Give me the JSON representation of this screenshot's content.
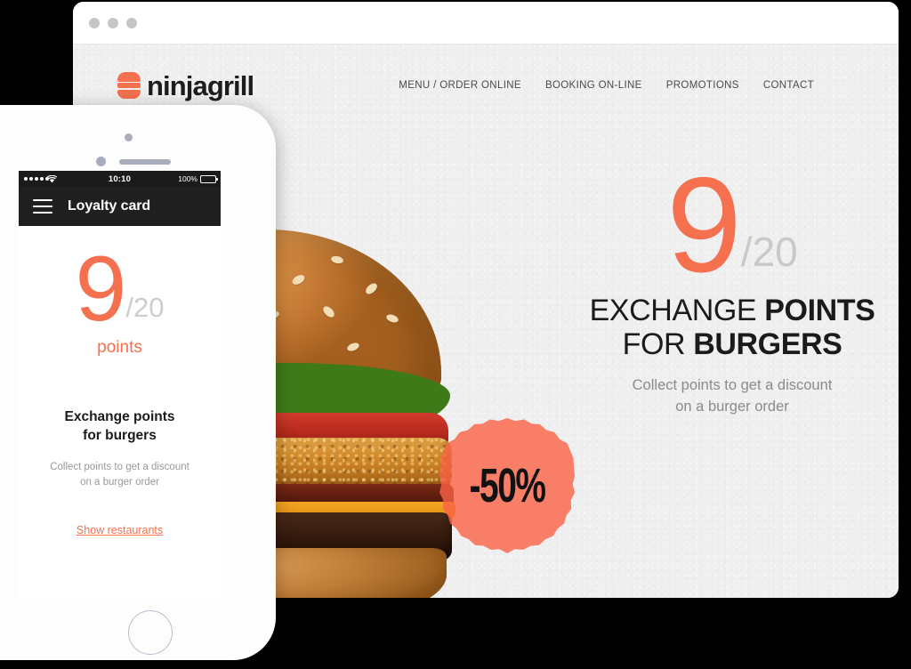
{
  "theme": {
    "accent": "#f4704f",
    "badge": "#fa6246",
    "dark": "#1f1f1f",
    "muted_gray": "#9a9a9a",
    "page_bg": "#efefef",
    "backdrop": "#000000"
  },
  "browser": {
    "window_dots": [
      "dot-1",
      "dot-2",
      "dot-3"
    ],
    "site": {
      "brand": {
        "logo_icon": "burger-logo-icon",
        "name": "ninjagrill"
      },
      "nav": [
        {
          "label": "MENU / ORDER ONLINE"
        },
        {
          "label": "BOOKING ON-LINE"
        },
        {
          "label": "PROMOTIONS"
        },
        {
          "label": "CONTACT"
        }
      ],
      "hero": {
        "image_alt": "burger-photo",
        "badge": {
          "icon": "starburst-badge-icon",
          "text": "-50%"
        }
      },
      "promo": {
        "points": "9",
        "points_total": "/20",
        "headline_line1_light": "EXCHANGE ",
        "headline_line1_bold": "POINTS",
        "headline_line2_light": "FOR ",
        "headline_line2_bold": "BURGERS",
        "subtitle_line1": "Collect points to get a discount",
        "subtitle_line2": "on a burger order"
      }
    }
  },
  "phone": {
    "hardware": {
      "camera": "front-camera",
      "sensor": "proximity-sensor",
      "speaker": "earpiece-speaker",
      "home_button": "home-button"
    },
    "status_bar": {
      "signal": "signal-dots-icon",
      "wifi": "wifi-icon",
      "time": "10:10",
      "battery_percent": "100%",
      "battery": "battery-icon"
    },
    "app_bar": {
      "menu_icon": "hamburger-menu-icon",
      "title": "Loyalty card"
    },
    "app_body": {
      "points": "9",
      "points_total": "/20",
      "points_label": "points",
      "headline_line1": "Exchange points",
      "headline_line2": "for burgers",
      "subtitle_line1": "Collect points to get a discount",
      "subtitle_line2": "on a burger order",
      "link_label": "Show restaurants"
    }
  }
}
